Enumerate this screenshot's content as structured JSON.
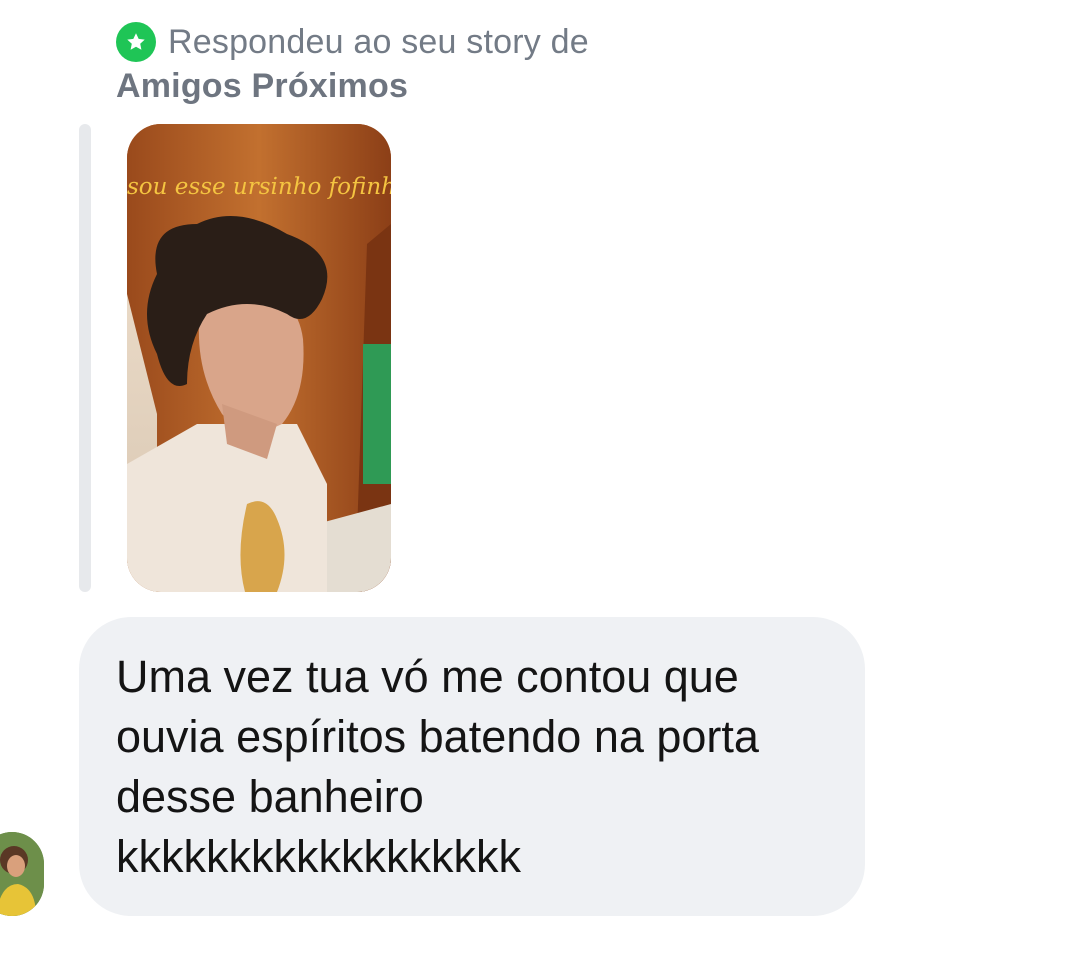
{
  "reply_header": {
    "text": "Respondeu ao seu story de",
    "audience": "Amigos Próximos",
    "badge_icon": "star-icon",
    "badge_color": "#1fc556"
  },
  "story": {
    "caption": "sou esse ursinho fofinho"
  },
  "message": {
    "text": "Uma vez tua vó me contou que\nouvia espíritos batendo na porta\ndesse banheiro\nkkkkkkkkkkkkkkkkkk"
  },
  "colors": {
    "bubble_background": "#eff1f4",
    "muted_text": "#737b86",
    "message_text": "#141414",
    "caption_color": "#f4c441"
  }
}
